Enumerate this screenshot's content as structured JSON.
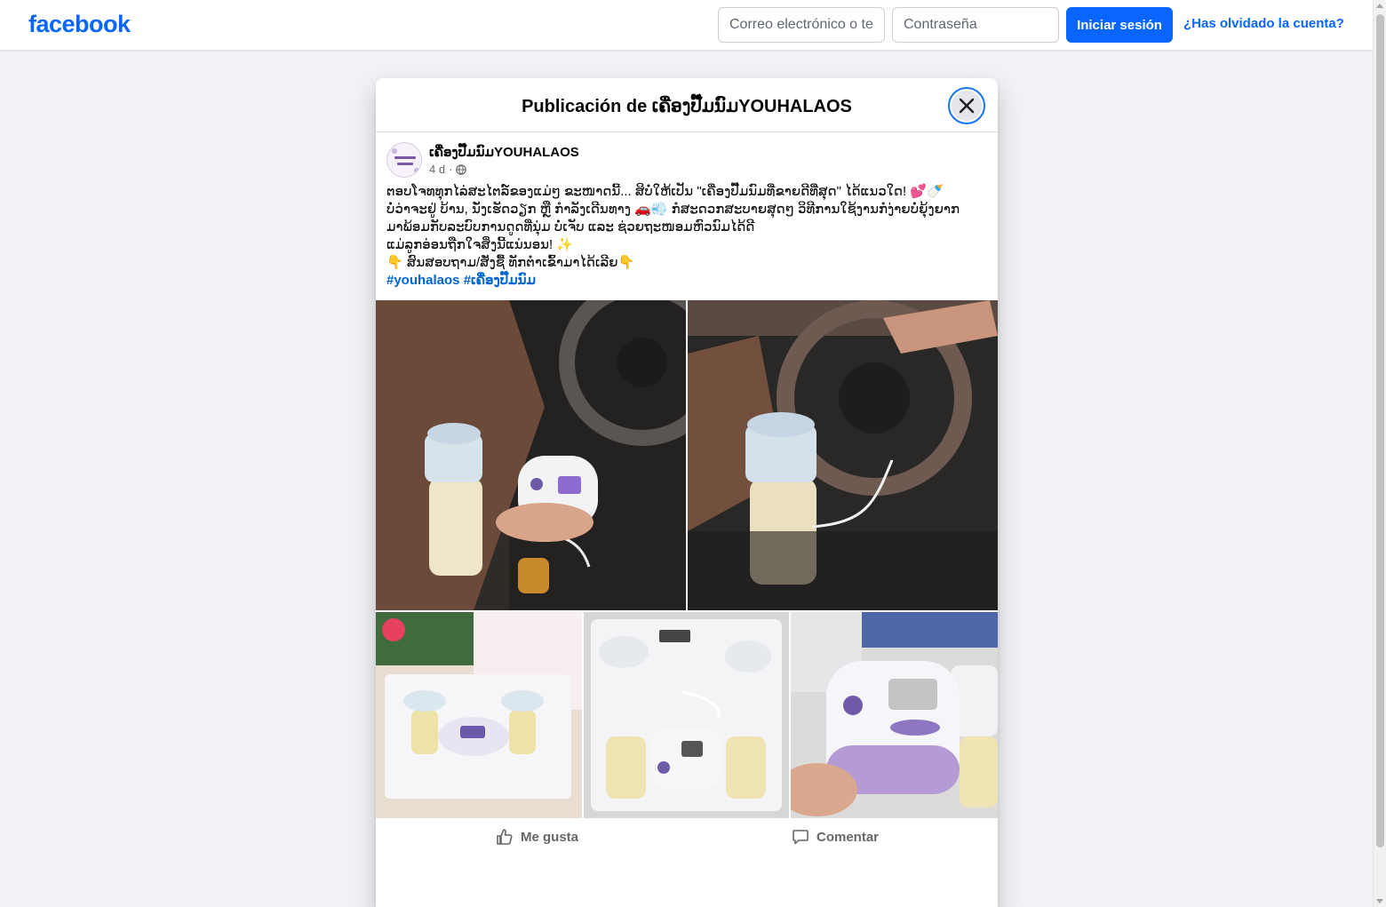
{
  "header": {
    "logo": "facebook",
    "email_placeholder": "Correo electrónico o teléfono",
    "password_placeholder": "Contraseña",
    "login_label": "Iniciar sesión",
    "forgot_label": "¿Has olvidado la cuenta?"
  },
  "dialog": {
    "title": "Publicación de ເຄື່ອງປັ໊ມນົມYOUHALAOS"
  },
  "post": {
    "page_name": "ເຄື່ອງປັ໊ມນົມYOUHALAOS",
    "time": "4 d",
    "separator": "·",
    "lines": [
      "ຕອບໂຈທທຸກໄລ່ສະໄຕລ໌ຂອງແມ່ໆ ຂະໜາດນີ້... ສິບໍ່ໃຫ້ເປັນ \"ເຄື່ອງປັ໊ມນົມທີ່ຂາຍດີທີ່ສຸດ\" ໄດ້ແນວໃດ! 💕🍼",
      "ບໍ່ວ່າຈະຢູ່ ບ້ານ, ນັ່ງເຮັດວຽກ ຫຼື ກຳລັງເດີນທາງ 🚗💨 ກໍສະດວກສະບາຍສຸດໆ ວິທີການໃຊ້ງານກໍງ່າຍບໍ່ຍຸ້ງຍາກ",
      "ມາພ້ອມກັບລະບົບການດູດທີ່ນຸ່ມ  ບໍ່ເຈັບ ແລະ ຊ່ວຍຖະໜອມຫົວນົມໄດ້ດີ",
      "ແມ່ລູກອ່ອນຖືກໃຈສິ່ງນີ້ແນ່ນອນ! ✨",
      "👇 ສົນສອບຖາມ/ສັ່ງຊື້ ທັກຕຳເຂົ້າມາໄດ້ເລີຍ👇"
    ],
    "hashtags": [
      "#youhalaos",
      "#ເຄື່ອງປັ໊ມນົມ"
    ]
  },
  "actions": {
    "like_label": "Me gusta",
    "comment_label": "Comentar"
  },
  "colors": {
    "brand": "#0866ff",
    "link": "#0064d1",
    "page_bg": "#f0f2f5"
  }
}
